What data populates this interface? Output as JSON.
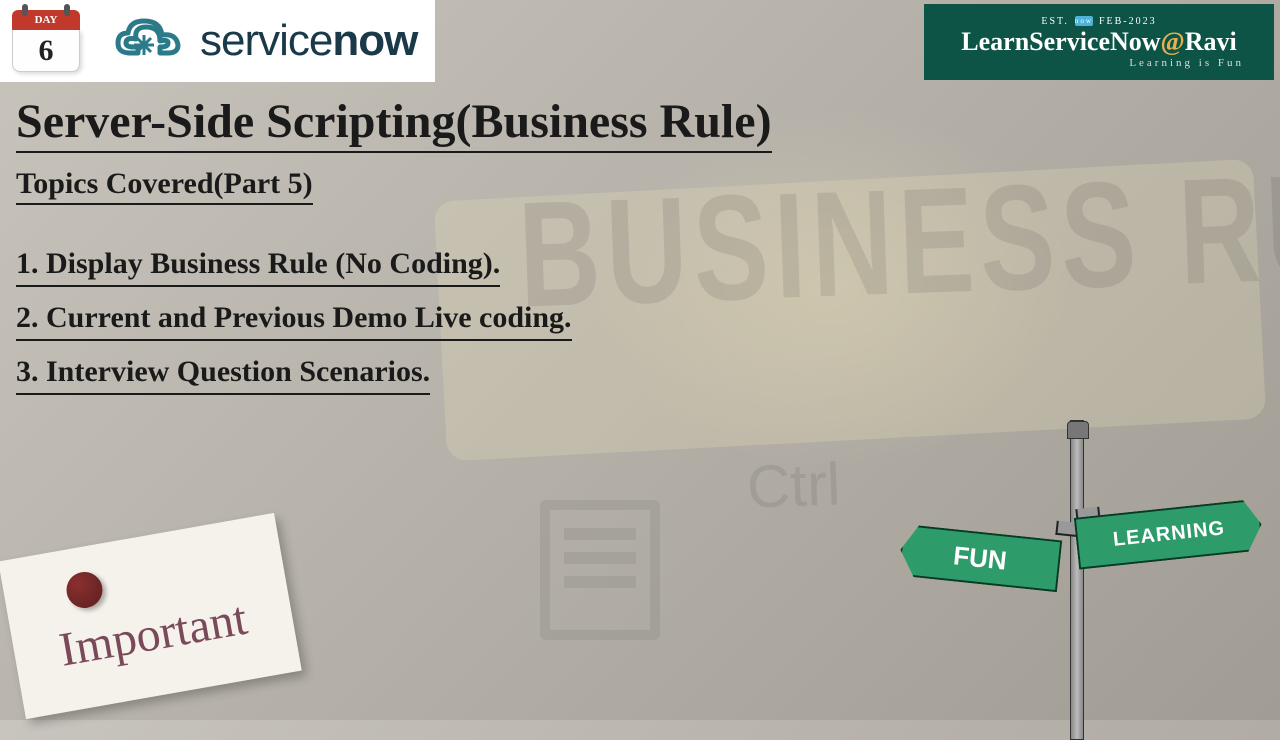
{
  "calendar": {
    "label": "DAY",
    "number": "6"
  },
  "logo": {
    "brand_prefix": "service",
    "brand_bold": "now"
  },
  "channel": {
    "est_left": "EST.",
    "est_badge": "now",
    "est_right": "FEB-2023",
    "name_main": "LearnServiceNow",
    "name_at": "@",
    "name_author": "Ravi",
    "tagline": "Learning is Fun"
  },
  "title": "Server-Side Scripting(Business Rule)",
  "subtitle": "Topics Covered(Part 5)",
  "topics": [
    "1. Display Business Rule (No Coding).",
    "2. Current and Previous Demo Live coding.",
    "3. Interview Question Scenarios."
  ],
  "important_label": "Important",
  "sign_fun": "FUN",
  "sign_learning": "LEARNING",
  "bg_business_rules": "BUSINESS RULES",
  "bg_ctrl": "Ctrl"
}
